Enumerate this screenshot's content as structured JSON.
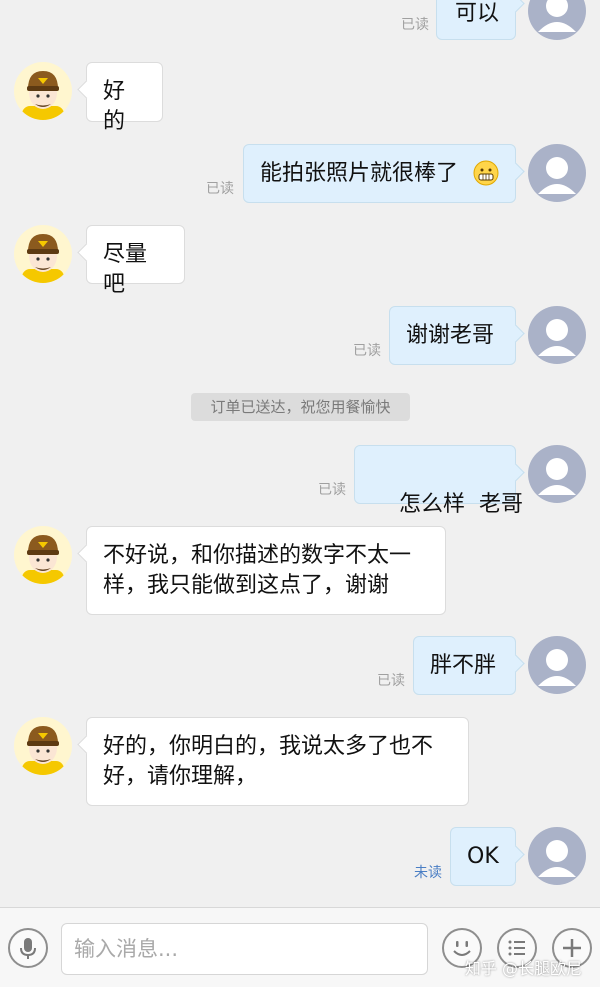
{
  "messages": [
    {
      "side": "out",
      "text": "可以",
      "status": "已读"
    },
    {
      "side": "in",
      "text": "好的"
    },
    {
      "side": "out",
      "text": "能拍张照片就很棒了",
      "emoji": "grin-emoji",
      "status": "已读"
    },
    {
      "side": "in",
      "text": "尽量吧"
    },
    {
      "side": "out",
      "text": "谢谢老哥",
      "status": "已读"
    },
    {
      "side": "out",
      "text": "怎么样  老哥",
      "status": "已读"
    },
    {
      "side": "in",
      "line1": "不好说，和你描述的数字不太一",
      "line2": "样，我只能做到这点了，谢谢"
    },
    {
      "side": "out",
      "text": "胖不胖",
      "status": "已读"
    },
    {
      "side": "in",
      "line1": "好的，你明白的，我说太多了也不",
      "line2": "好，请你理解，"
    },
    {
      "side": "out",
      "text": "OK",
      "status": "未读"
    }
  ],
  "notice": "订单已送达，祝您用餐愉快",
  "input": {
    "placeholder": "输入消息..."
  },
  "icons": {
    "voice": "microphone-icon",
    "emoji": "emoji-icon",
    "menu": "list-icon",
    "more": "plus-icon"
  },
  "watermark": "知乎 @长腿欧尼",
  "colors": {
    "out_bubble": "#dff0fd",
    "in_bubble": "#ffffff",
    "unread": "#4a7ec4",
    "background": "#f0f0f0"
  }
}
